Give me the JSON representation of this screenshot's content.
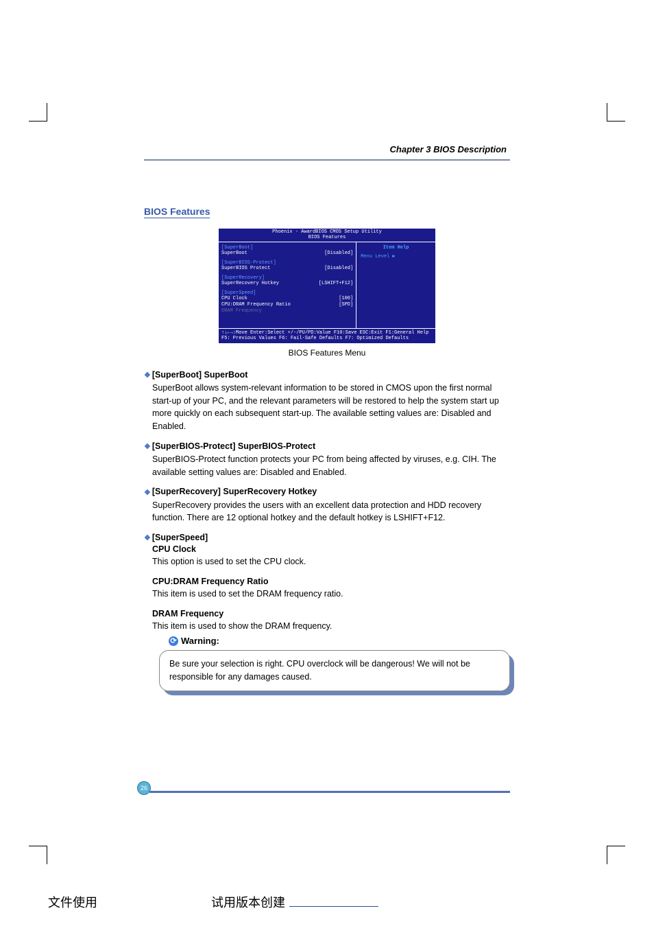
{
  "header": {
    "chapter": "Chapter 3    BIOS Description"
  },
  "section_title": "BIOS Features",
  "bios": {
    "title_line1": "Phoenix - AwardBIOS CMOS Setup Utility",
    "title_line2": "BIOS Features",
    "help_title": "Item Help",
    "menu_level": "Menu Level    ▶",
    "g1_label": "[SuperBoot]",
    "g1_item": "SuperBoot",
    "g1_val": "[Disabled]",
    "g2_label": "[SuperBIOS-Protect]",
    "g2_item": "SuperBIOS Protect",
    "g2_val": "[Disabled]",
    "g3_label": "[SuperRecovery]",
    "g3_item": "SuperRecovery Hotkey",
    "g3_val": "[LSHIFT+F12]",
    "g4_label": "[SuperSpeed]",
    "g4_item1": "CPU Clock",
    "g4_val1": "[100]",
    "g4_item2": "CPU:DRAM Frequency Ratio",
    "g4_val2": "[SPD]",
    "g4_item3": "DRAM Frequency",
    "footer1": "↑↓←→:Move  Enter:Select  +/-/PU/PD:Value  F10:Save  ESC:Exit  F1:General Help",
    "footer2": "F5: Previous Values    F6: Fail-Safe Defaults    F7: Optimized Defaults"
  },
  "caption": "BIOS Features Menu",
  "items": {
    "superboot_head": "[SuperBoot] SuperBoot",
    "superboot_body": "SuperBoot allows system-relevant information to be stored in CMOS upon the first normal start-up of your PC, and the relevant parameters will be restored to help the system start up more quickly on each subsequent start-up. The available setting values are: Disabled and Enabled.",
    "sbp_head": "[SuperBIOS-Protect] SuperBIOS-Protect",
    "sbp_body": "SuperBIOS-Protect function protects your PC from being affected by viruses, e.g. CIH. The available setting values are: Disabled and Enabled.",
    "srec_head": "[SuperRecovery] SuperRecovery Hotkey",
    "srec_body": "SuperRecovery provides the users with an excellent data protection and HDD recovery function. There are 12 optional hotkey and the default hotkey is LSHIFT+F12.",
    "sspeed_head": "[SuperSpeed]",
    "cpu_clock_head": "CPU Clock",
    "cpu_clock_body": "This option is used to set the CPU clock.",
    "ratio_head": "CPU:DRAM Frequency Ratio",
    "ratio_body": "This item is used to set the DRAM frequency ratio.",
    "dram_head": "DRAM Frequency",
    "dram_body": "This item is used to show the DRAM frequency."
  },
  "warning": {
    "label": "Warning:",
    "body": "Be sure your selection is right. CPU overclock will be dangerous! We will not be responsible for any damages caused."
  },
  "page_number": "26",
  "footer_cn_left": "文件使用",
  "footer_cn_mid": "试用版本创建"
}
